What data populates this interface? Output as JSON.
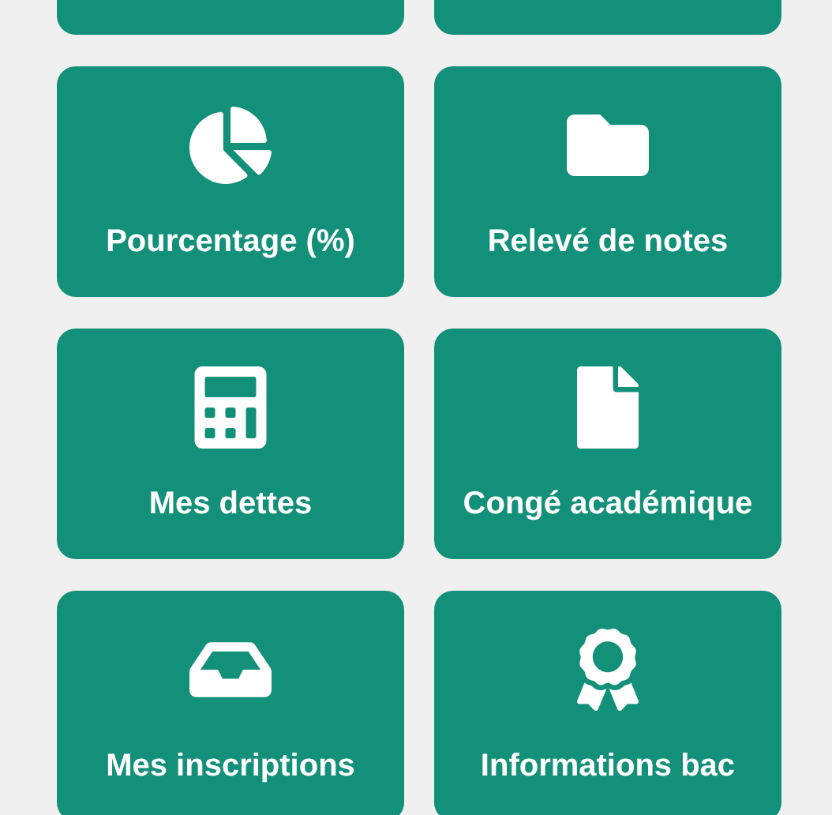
{
  "tiles": [
    {
      "kind": "blank"
    },
    {
      "kind": "blank"
    },
    {
      "kind": "pie",
      "label": "Pourcentage (%)"
    },
    {
      "kind": "folder",
      "label": "Relevé de notes"
    },
    {
      "kind": "calculator",
      "label": "Mes dettes"
    },
    {
      "kind": "file",
      "label": "Congé académique"
    },
    {
      "kind": "inbox",
      "label": "Mes inscriptions"
    },
    {
      "kind": "award",
      "label": "Informations bac"
    }
  ]
}
